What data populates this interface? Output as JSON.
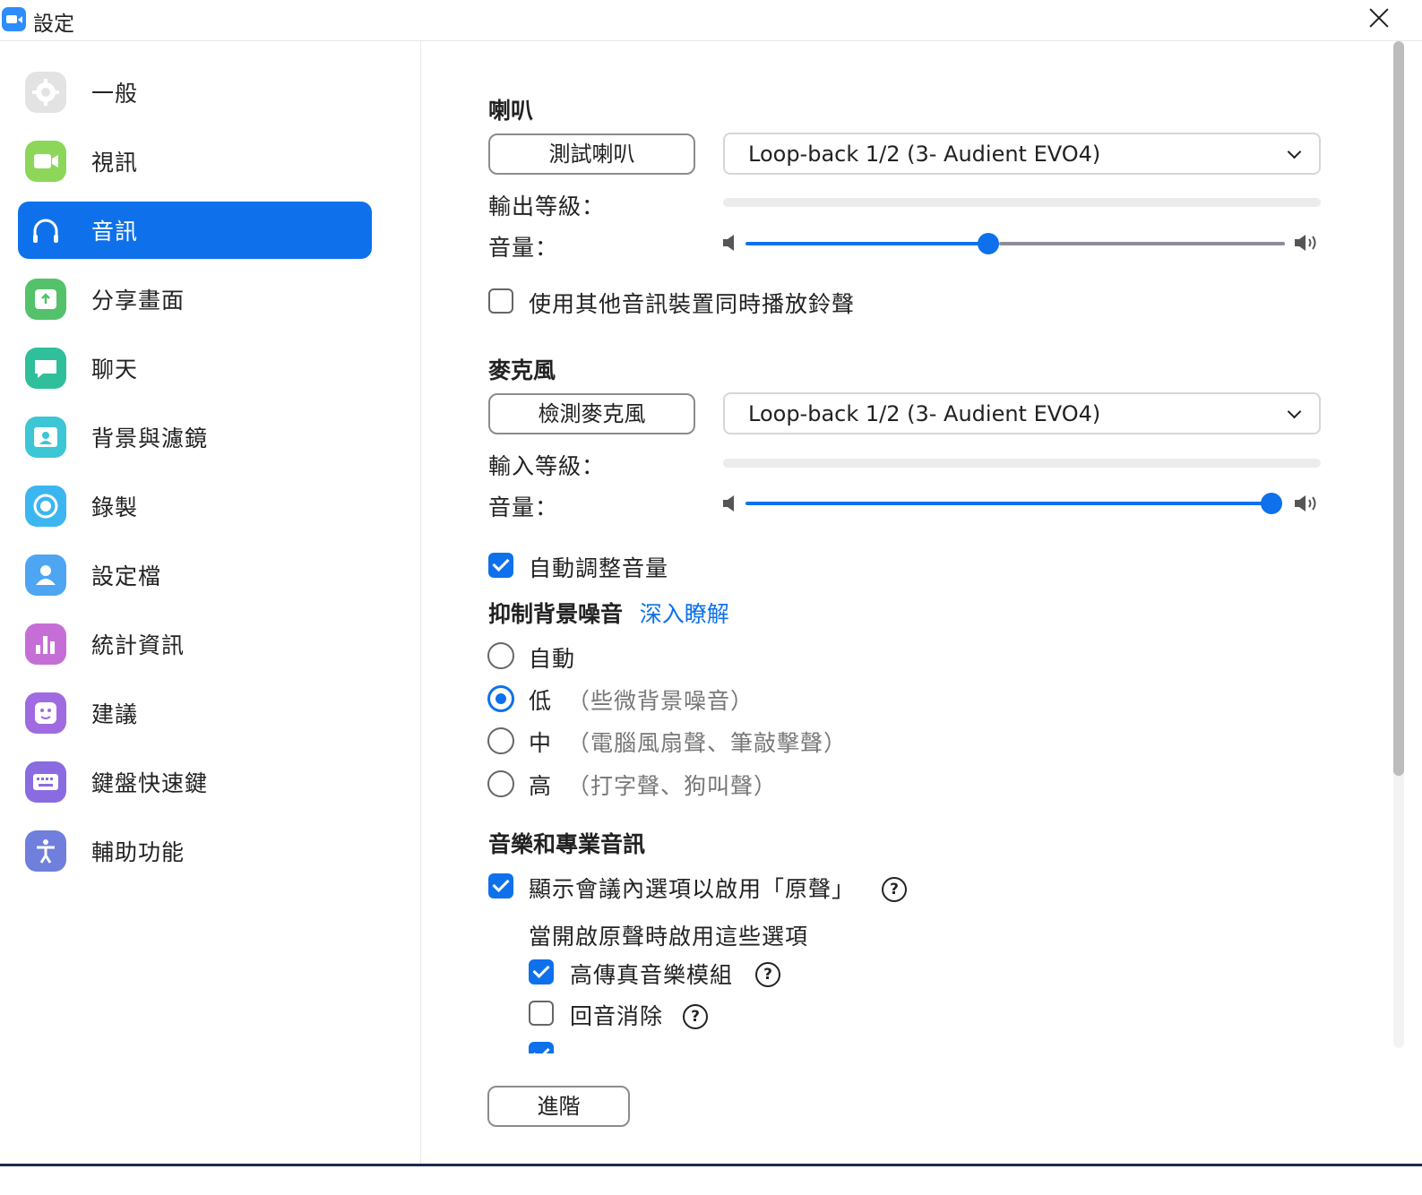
{
  "window": {
    "title": "設定"
  },
  "sidebar": {
    "items": [
      {
        "label": "一般",
        "icon": "gear-icon",
        "color": "#e3e3e3"
      },
      {
        "label": "視訊",
        "icon": "video-camera-icon",
        "color": "#8cd65a"
      },
      {
        "label": "音訊",
        "icon": "headphones-icon",
        "color": "#0e71eb"
      },
      {
        "label": "分享畫面",
        "icon": "share-screen-icon",
        "color": "#53c26a"
      },
      {
        "label": "聊天",
        "icon": "chat-bubble-icon",
        "color": "#2fbf9a"
      },
      {
        "label": "背景與濾鏡",
        "icon": "background-portrait-icon",
        "color": "#3cc6d6"
      },
      {
        "label": "錄製",
        "icon": "record-icon",
        "color": "#3cb6f0"
      },
      {
        "label": "設定檔",
        "icon": "profile-icon",
        "color": "#4ea5f2"
      },
      {
        "label": "統計資訊",
        "icon": "statistics-icon",
        "color": "#c56fd6"
      },
      {
        "label": "建議",
        "icon": "feedback-smile-icon",
        "color": "#a06be0"
      },
      {
        "label": "鍵盤快速鍵",
        "icon": "keyboard-icon",
        "color": "#8a6ce0"
      },
      {
        "label": "輔助功能",
        "icon": "accessibility-icon",
        "color": "#6f7fdb"
      }
    ],
    "active_index": 2
  },
  "speaker": {
    "title": "喇叭",
    "test_button": "測試喇叭",
    "device": "Loop-back 1/2 (3- Audient EVO4)",
    "output_level_label": "輸出等級：",
    "output_level": 0,
    "volume_label": "音量：",
    "volume": 0.45,
    "separate_ringtone_label": "使用其他音訊裝置同時播放鈴聲",
    "separate_ringtone_checked": false
  },
  "microphone": {
    "title": "麥克風",
    "test_button": "檢測麥克風",
    "device": "Loop-back 1/2 (3- Audient EVO4)",
    "input_level_label": "輸入等級：",
    "input_level": 0,
    "volume_label": "音量：",
    "volume": 1.0,
    "auto_adjust_label": "自動調整音量",
    "auto_adjust_checked": true
  },
  "noise": {
    "title": "抑制背景噪音",
    "learn_more": "深入瞭解",
    "options": [
      {
        "label": "自動",
        "hint": ""
      },
      {
        "label": "低",
        "hint": "（些微背景噪音）"
      },
      {
        "label": "中",
        "hint": "（電腦風扇聲、筆敲擊聲）"
      },
      {
        "label": "高",
        "hint": "（打字聲、狗叫聲）"
      }
    ],
    "selected_index": 1
  },
  "music": {
    "title": "音樂和專業音訊",
    "original_sound_label": "顯示會議內選項以啟用「原聲」",
    "original_sound_checked": true,
    "sub_title": "當開啟原聲時啟用這些選項",
    "hifi_label": "高傳真音樂模組",
    "hifi_checked": true,
    "echo_label": "回音消除",
    "echo_checked": false
  },
  "advanced_button": "進階",
  "accent_color": "#0e71eb"
}
